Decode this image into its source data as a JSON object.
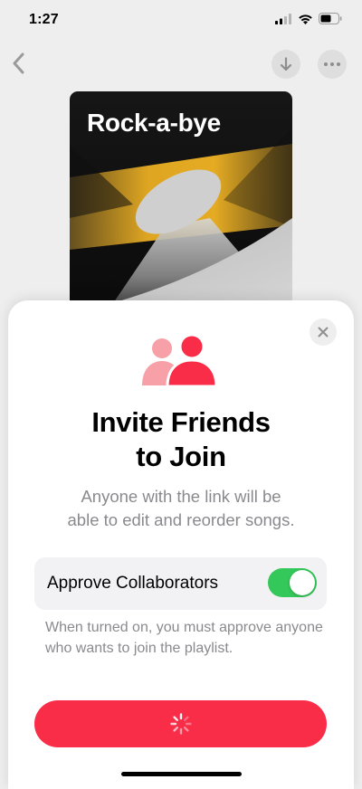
{
  "status_bar": {
    "time": "1:27",
    "icons": [
      "cellular-signal-icon",
      "wifi-icon",
      "battery-icon"
    ]
  },
  "nav": {
    "back_icon": "chevron-left-icon",
    "download_icon": "arrow-down-icon",
    "more_icon": "ellipsis-icon"
  },
  "playlist": {
    "artwork_title": "Rock-a-bye"
  },
  "sheet": {
    "close_icon": "close-icon",
    "people_icon": "people-icon",
    "title_line1": "Invite Friends",
    "title_line2": "to Join",
    "description_line1": "Anyone with the link will be",
    "description_line2": "able to edit and reorder songs.",
    "setting": {
      "label": "Approve Collaborators",
      "enabled": true
    },
    "setting_note": "When turned on, you must approve anyone who wants to join the playlist.",
    "primary_button": {
      "state": "loading",
      "icon": "spinner-icon"
    }
  },
  "colors": {
    "accent_red": "#fa2d48",
    "toggle_green": "#34c759",
    "secondary_text": "#8a8a8e",
    "artwork_yellow": "#f0b323"
  }
}
